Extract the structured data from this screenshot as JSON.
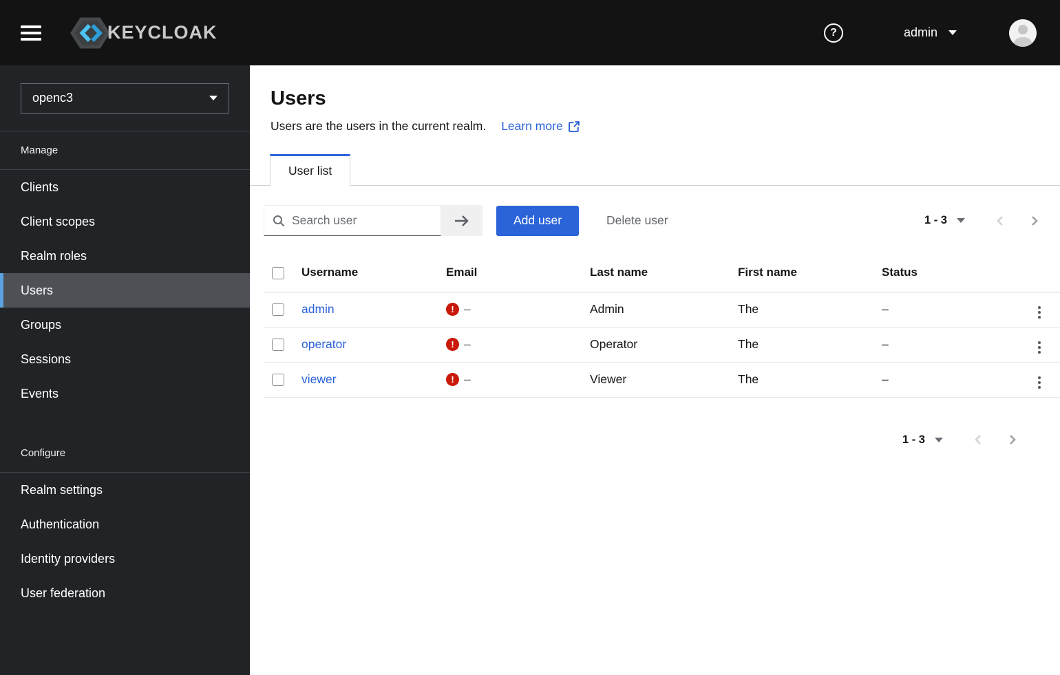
{
  "colors": {
    "accent_blue": "#2b63d9",
    "danger_red": "#c9190b",
    "masthead_bg": "#131313",
    "sidebar_bg": "#212427",
    "nav_current_bg": "#4d5156",
    "nav_current_indicator": "#5ba3e0"
  },
  "header": {
    "brand": "KEYCLOAK",
    "help_glyph": "?",
    "username": "admin"
  },
  "sidebar": {
    "realm": "openc3",
    "sections": [
      {
        "label": "Manage",
        "items": [
          "Clients",
          "Client scopes",
          "Realm roles",
          "Users",
          "Groups",
          "Sessions",
          "Events"
        ]
      },
      {
        "label": "Configure",
        "items": [
          "Realm settings",
          "Authentication",
          "Identity providers",
          "User federation"
        ]
      }
    ]
  },
  "main": {
    "title": "Users",
    "subtitle": "Users are the users in the current realm.",
    "learn_more_label": "Learn more",
    "tab_label": "User list",
    "toolbar": {
      "search_placeholder": "Search user",
      "add_user_label": "Add user",
      "delete_user_label": "Delete user"
    },
    "pagination": {
      "range": "1 - 3"
    },
    "table": {
      "columns": [
        "Username",
        "Email",
        "Last name",
        "First name",
        "Status"
      ],
      "rows": [
        {
          "username": "admin",
          "email": "–",
          "last_name": "Admin",
          "first_name": "The",
          "status": "–"
        },
        {
          "username": "operator",
          "email": "–",
          "last_name": "Operator",
          "first_name": "The",
          "status": "–"
        },
        {
          "username": "viewer",
          "email": "–",
          "last_name": "Viewer",
          "first_name": "The",
          "status": "–"
        }
      ]
    }
  }
}
